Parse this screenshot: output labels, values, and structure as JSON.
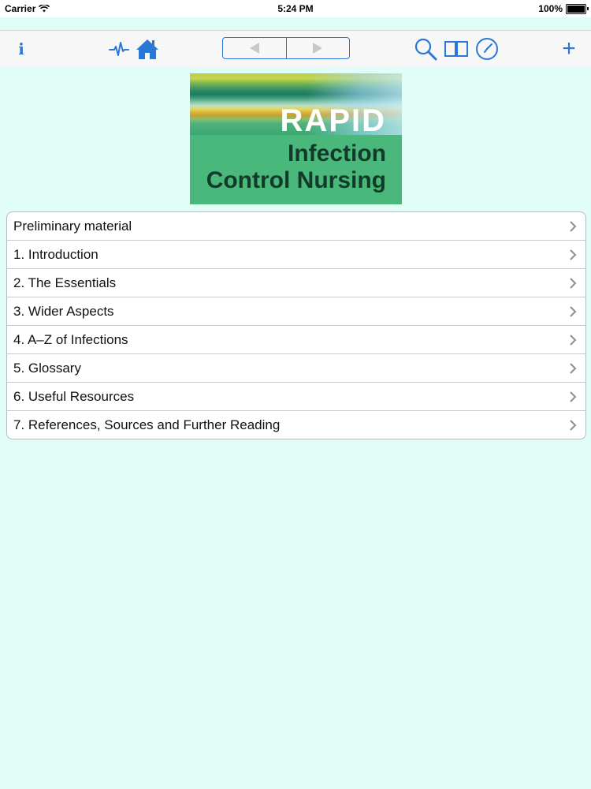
{
  "status_bar": {
    "carrier": "Carrier",
    "time": "5:24 PM",
    "battery": "100%"
  },
  "toolbar": {
    "info_label": "i",
    "plus_label": "+",
    "icons": [
      "info-icon",
      "pulse-icon",
      "home-icon",
      "back-arrow-icon",
      "forward-arrow-icon",
      "search-icon",
      "book-icon",
      "clock-icon",
      "plus-icon"
    ],
    "accent_color": "#2a78d6"
  },
  "cover": {
    "word1": "RAPID",
    "line2": "Infection",
    "line3": "Control Nursing"
  },
  "toc": {
    "items": [
      {
        "label": "Preliminary material"
      },
      {
        "label": "1. Introduction"
      },
      {
        "label": "2. The Essentials"
      },
      {
        "label": "3. Wider Aspects"
      },
      {
        "label": "4. A–Z of Infections"
      },
      {
        "label": "5. Glossary"
      },
      {
        "label": "6. Useful Resources"
      },
      {
        "label": "7. References, Sources and Further Reading"
      }
    ]
  },
  "colors": {
    "background": "#e0fdf8",
    "cover_green": "#4ab87a",
    "chevron": "#8e8e93"
  }
}
